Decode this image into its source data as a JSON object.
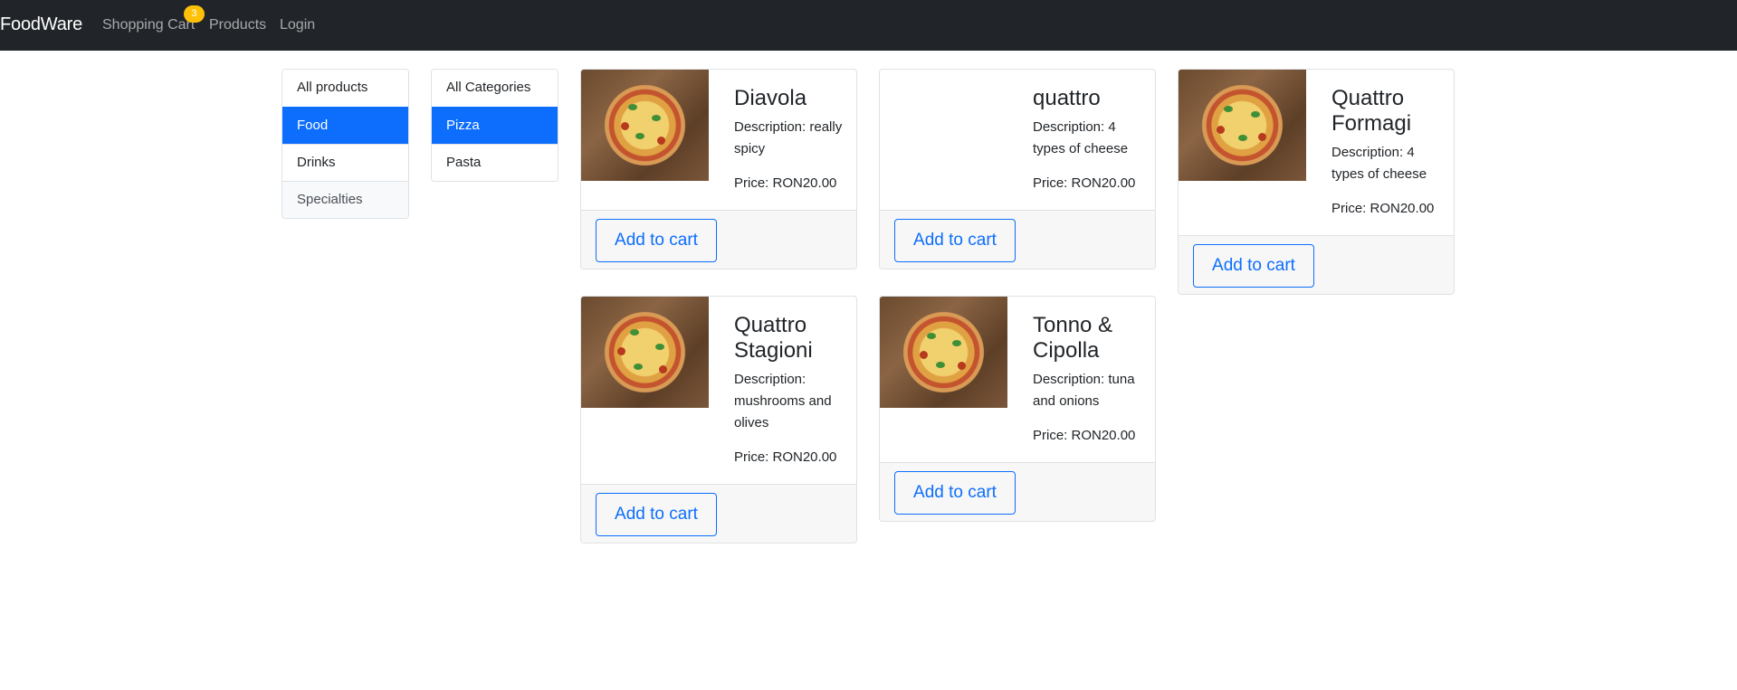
{
  "navbar": {
    "brand": "FoodWare",
    "links": [
      "Shopping Cart",
      "Products",
      "Login"
    ],
    "cart_badge_count": "3",
    "background_color": "#212529"
  },
  "product_filter": {
    "items": [
      "All products",
      "Food",
      "Drinks",
      "Specialties"
    ],
    "active": "Food"
  },
  "category_filter": {
    "items": [
      "All Categories",
      "Pizza",
      "Pasta"
    ],
    "active": "Pizza"
  },
  "colors": {
    "accent": "#0d6efd",
    "badge": "#ffc107"
  },
  "products": [
    {
      "name": "Diavola",
      "description": "Description: really spicy",
      "price": "Price: RON20.00",
      "button": "Add to cart",
      "has_image": true
    },
    {
      "name": "quattro",
      "description": "Description: 4 types of cheese",
      "price": "Price: RON20.00",
      "button": "Add to cart",
      "has_image": false
    },
    {
      "name": "Quattro Formagi",
      "description": "Description: 4 types of cheese",
      "price": "Price: RON20.00",
      "button": "Add to cart",
      "has_image": true
    },
    {
      "name": "Quattro Stagioni",
      "description": "Description: mushrooms and olives",
      "price": "Price: RON20.00",
      "button": "Add to cart",
      "has_image": true
    },
    {
      "name": "Tonno & Cipolla",
      "description": "Description: tuna and onions",
      "price": "Price: RON20.00",
      "button": "Add to cart",
      "has_image": true
    }
  ]
}
